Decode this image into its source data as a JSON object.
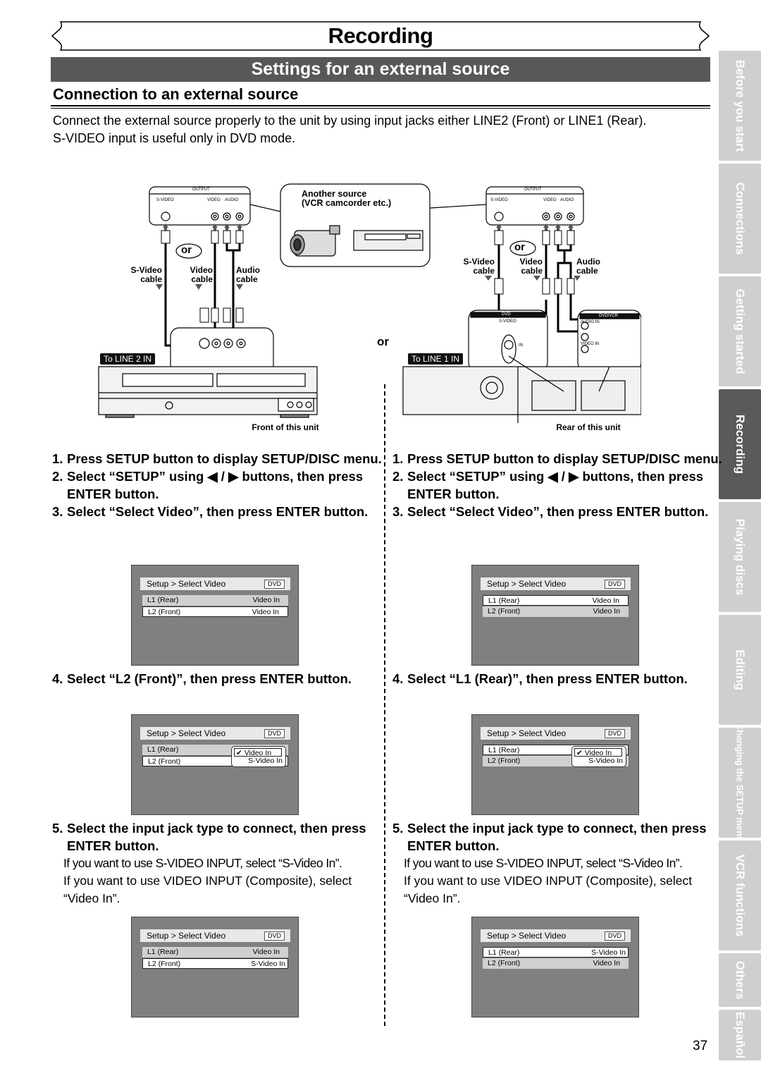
{
  "header": {
    "chapter_title": "Recording",
    "section_title": "Settings for an external source",
    "sub_heading": "Connection to an external source",
    "intro_line1": "Connect the external source properly to the unit by using input jacks either LINE2 (Front) or LINE1 (Rear).",
    "intro_line2": "S-VIDEO input is useful only in DVD mode."
  },
  "side_tabs": [
    {
      "label": "Before you start",
      "active": false
    },
    {
      "label": "Connections",
      "active": false
    },
    {
      "label": "Getting started",
      "active": false
    },
    {
      "label": "Recording",
      "active": true
    },
    {
      "label": "Playing discs",
      "active": false
    },
    {
      "label": "Editing",
      "active": false
    },
    {
      "label": "Changing the SETUP menu",
      "active": false
    },
    {
      "label": "VCR functions",
      "active": false
    },
    {
      "label": "Others",
      "active": false
    },
    {
      "label": "Español",
      "active": false
    }
  ],
  "diagram": {
    "output_panel_title": "OUTPUT",
    "output_svideo": "S-VIDEO",
    "output_video": "VIDEO",
    "output_audio": "AUDIO",
    "another_source_line1": "Another source",
    "another_source_line2": "(VCR camcorder etc.)",
    "or_label": "or",
    "svideo_cable_1": "S-Video",
    "svideo_cable_2": "cable",
    "video_cable_1": "Video",
    "video_cable_2": "cable",
    "audio_cable_1": "Audio",
    "audio_cable_2": "cable",
    "to_line2": "To LINE 2 IN",
    "to_line1": "To LINE 1 IN",
    "front_caption": "Front of this unit",
    "rear_caption": "Rear of this unit",
    "rear_dvd_label": "DVD",
    "rear_dvdvcr_label": "DVD/VCR",
    "rear_svideo": "S-VIDEO",
    "rear_in": "IN",
    "rear_audio_in": "AUDIO IN",
    "rear_video_in": "VIDEO IN"
  },
  "left_column": {
    "steps_a": [
      {
        "num": "1.",
        "text": "Press SETUP button to display SETUP/DISC menu."
      },
      {
        "num": "2.",
        "text": "Select “SETUP” using ◀ / ▶ buttons, then press ENTER button."
      },
      {
        "num": "3.",
        "text": "Select “Select Video”, then press ENTER button."
      }
    ],
    "step4": {
      "num": "4.",
      "text": "Select “L2 (Front)”, then press ENTER button."
    },
    "step5": {
      "num": "5.",
      "text": "Select the input jack type to connect, then press ENTER button."
    },
    "note1": "If you want to use S-VIDEO INPUT, select “S-Video In”.",
    "note2": "If you want to use VIDEO INPUT (Composite), select “Video In”.",
    "screen1": {
      "crumb": "Setup > Select Video",
      "badge": "DVD",
      "rows": [
        {
          "label": "L1 (Rear)",
          "value": "Video In"
        },
        {
          "label": "L2 (Front)",
          "value": "Video In"
        }
      ]
    },
    "screen2": {
      "crumb": "Setup > Select Video",
      "badge": "DVD",
      "rows": [
        {
          "label": "L1 (Rear)",
          "value": ""
        },
        {
          "label": "L2 (Front)",
          "value": ""
        }
      ],
      "popup": {
        "checked": "Video In",
        "other": "S-Video In",
        "check_icon": "✔"
      }
    },
    "screen3": {
      "crumb": "Setup > Select Video",
      "badge": "DVD",
      "rows": [
        {
          "label": "L1 (Rear)",
          "value": "Video In"
        },
        {
          "label": "L2 (Front)",
          "value": "S-Video In"
        }
      ]
    }
  },
  "right_column": {
    "steps_a": [
      {
        "num": "1.",
        "text": "Press SETUP button to display SETUP/DISC menu."
      },
      {
        "num": "2.",
        "text": "Select “SETUP” using ◀ / ▶ buttons, then press ENTER button."
      },
      {
        "num": "3.",
        "text": "Select “Select Video”, then press ENTER button."
      }
    ],
    "step4": {
      "num": "4.",
      "text": "Select “L1 (Rear)”, then press ENTER button."
    },
    "step5": {
      "num": "5.",
      "text": "Select the input jack type to connect, then press ENTER button."
    },
    "note1": "If you want to use S-VIDEO INPUT, select “S-Video In”.",
    "note2": "If you want to use VIDEO INPUT (Composite), select “Video In”.",
    "screen1": {
      "crumb": "Setup > Select Video",
      "badge": "DVD",
      "rows": [
        {
          "label": "L1 (Rear)",
          "value": "Video In"
        },
        {
          "label": "L2 (Front)",
          "value": "Video In"
        }
      ]
    },
    "screen2": {
      "crumb": "Setup > Select Video",
      "badge": "DVD",
      "rows": [
        {
          "label": "L1 (Rear)",
          "value": ""
        },
        {
          "label": "L2 (Front)",
          "value": ""
        }
      ],
      "popup": {
        "checked": "Video In",
        "other": "S-Video In",
        "check_icon": "✔"
      }
    },
    "screen3": {
      "crumb": "Setup > Select Video",
      "badge": "DVD",
      "rows": [
        {
          "label": "L1 (Rear)",
          "value": "S-Video In"
        },
        {
          "label": "L2 (Front)",
          "value": "Video In"
        }
      ]
    }
  },
  "footer": {
    "page_number": "37"
  }
}
